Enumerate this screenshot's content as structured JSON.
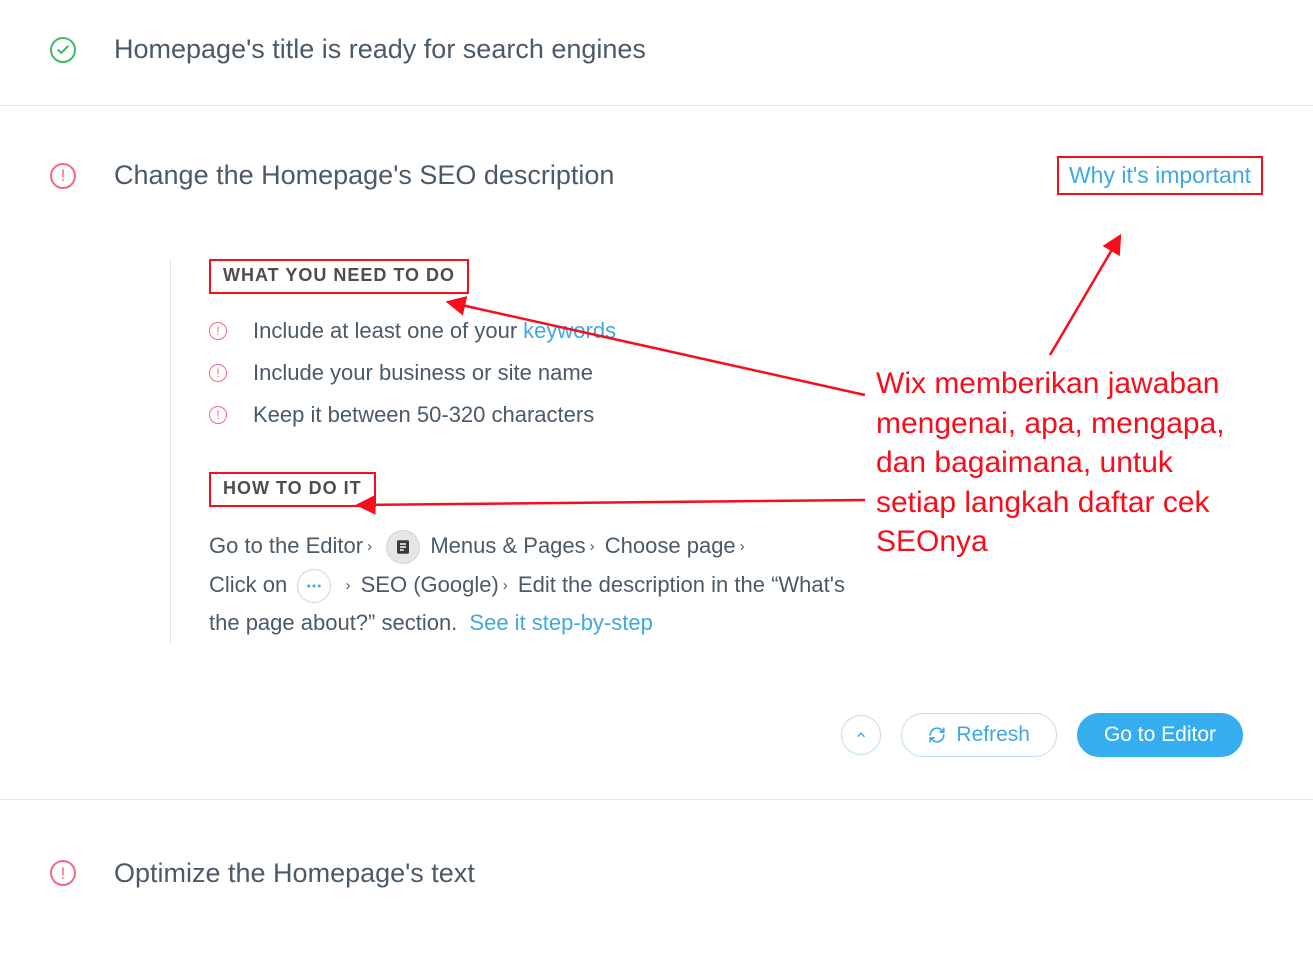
{
  "ready": {
    "title": "Homepage's title is ready for search engines"
  },
  "change": {
    "title": "Change the Homepage's SEO description",
    "why_link": "Why it's important",
    "what_heading": "WHAT YOU NEED TO DO",
    "bullets": {
      "b1_pre": "Include at least one of your",
      "b1_link": "keywords",
      "b2": "Include your business or site name",
      "b3": "Keep it between 50-320 characters"
    },
    "how_heading": "HOW TO DO IT",
    "steps": {
      "s1": "Go to the Editor",
      "s2": "Menus & Pages",
      "s3": "Choose page",
      "s4": "Click on",
      "s5": "SEO (Google)",
      "s6a": "Edit the description in the “What's",
      "s6b": "the page about?” section.",
      "link": "See it step-by-step"
    },
    "actions": {
      "refresh": "Refresh",
      "go_editor": "Go to Editor"
    }
  },
  "optimize": {
    "title": "Optimize the Homepage's text"
  },
  "annotation": {
    "text": "Wix memberikan jawaban mengenai, apa, mengapa, dan bagaimana, untuk setiap langkah daftar cek SEOnya"
  }
}
